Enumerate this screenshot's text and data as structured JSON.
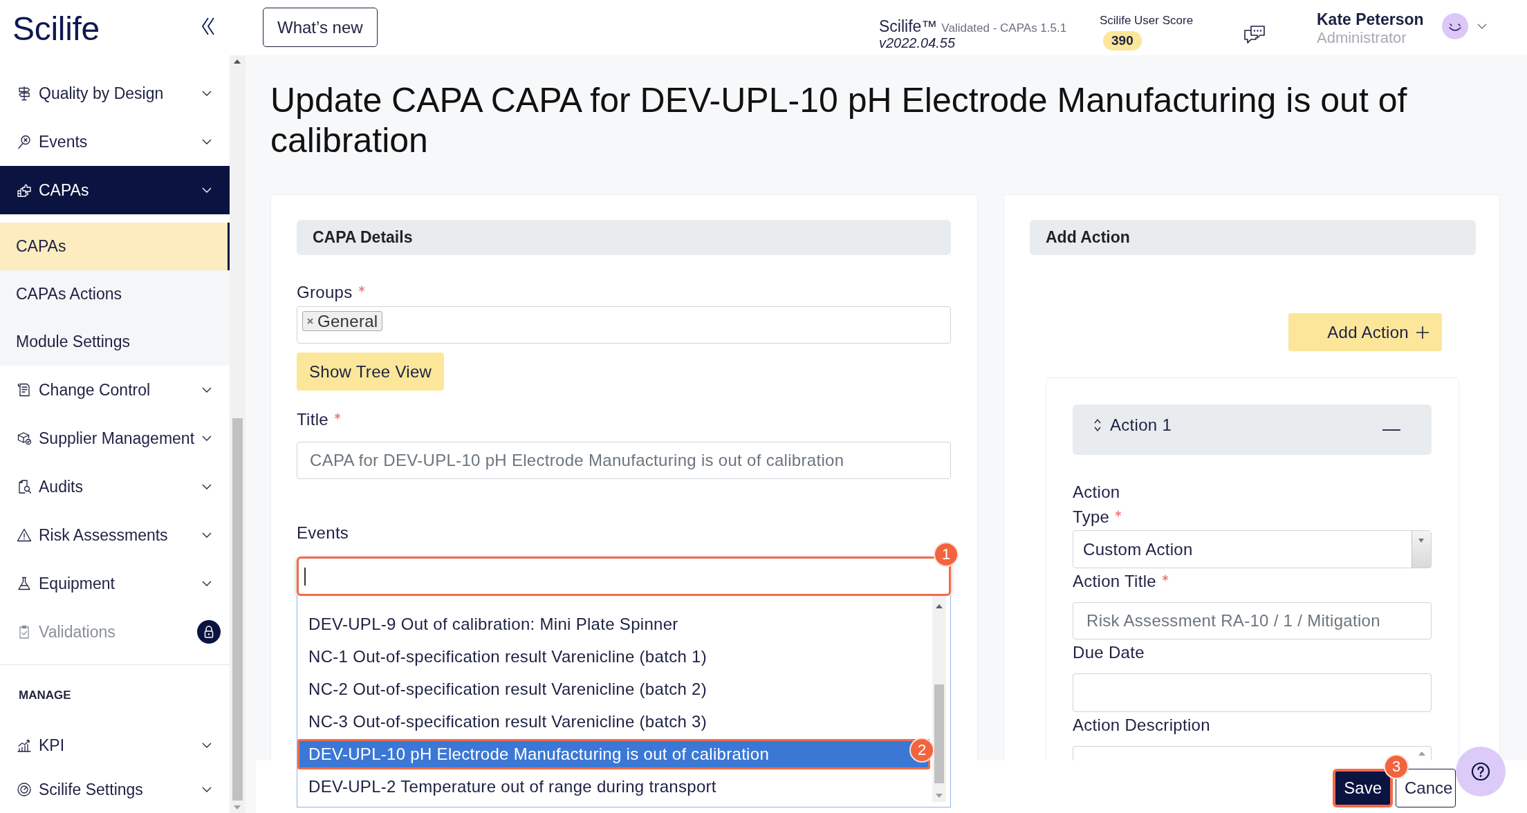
{
  "header": {
    "logo": "Scilife",
    "whats_new": "What’s new",
    "product": {
      "name": "Scilife™",
      "edition": "Validated - CAPAs 1.5.1",
      "version": "v2022.04.55"
    },
    "score": {
      "label": "Scilife User Score",
      "value": "390"
    },
    "user": {
      "name": "Kate Peterson",
      "role": "Administrator"
    }
  },
  "sidebar": {
    "sections": [
      {
        "items": [
          {
            "label": "Quality by Design",
            "expanded": false,
            "locked": false
          },
          {
            "label": "Events",
            "expanded": false,
            "locked": false
          },
          {
            "label": "CAPAs",
            "expanded": true,
            "locked": false,
            "children": [
              {
                "label": "CAPAs",
                "selected": true
              },
              {
                "label": "CAPAs Actions",
                "selected": false
              },
              {
                "label": "Module Settings",
                "selected": false
              }
            ]
          },
          {
            "label": "Change Control",
            "expanded": false,
            "locked": false
          },
          {
            "label": "Supplier Management",
            "expanded": false,
            "locked": false
          },
          {
            "label": "Audits",
            "expanded": false,
            "locked": false
          },
          {
            "label": "Risk Assessments",
            "expanded": false,
            "locked": false
          },
          {
            "label": "Equipment",
            "expanded": false,
            "locked": false
          },
          {
            "label": "Validations",
            "expanded": false,
            "locked": true
          }
        ]
      },
      {
        "heading": "MANAGE",
        "items": [
          {
            "label": "KPI",
            "expanded": false,
            "locked": false
          },
          {
            "label": "Scilife Settings",
            "expanded": false,
            "locked": false
          }
        ]
      }
    ]
  },
  "page_title": "Update CAPA CAPA for DEV-UPL-10 pH Electrode Manufacturing is out of calibration",
  "capa_details": {
    "heading": "CAPA Details",
    "groups": {
      "label": "Groups",
      "required": true,
      "tags": [
        "General"
      ]
    },
    "tree_button": "Show Tree View",
    "title_field": {
      "label": "Title",
      "required": true,
      "value": "CAPA for DEV-UPL-10 pH Electrode Manufacturing is out of calibration",
      "disabled": true
    },
    "events": {
      "label": "Events",
      "required": false,
      "search": {
        "focused": true,
        "callout": "1"
      },
      "options": [
        {
          "label": "DEV-UPL-9 Out of calibration: Mini Plate Spinner",
          "selected": false
        },
        {
          "label": "NC-1 Out-of-specification result Varenicline (batch 1)",
          "selected": false
        },
        {
          "label": "NC-2 Out-of-specification result Varenicline (batch 2)",
          "selected": false
        },
        {
          "label": "NC-3 Out-of-specification result Varenicline (batch 3)",
          "selected": false
        },
        {
          "label": "DEV-UPL-10 pH Electrode Manufacturing is out of calibration",
          "selected": true,
          "callout": "2"
        },
        {
          "label": "DEV-UPL-2 Temperature out of range during transport",
          "selected": false
        }
      ]
    }
  },
  "add_action": {
    "heading": "Add Action",
    "add_button": "Add Action",
    "actions": [
      {
        "title": "Action 1",
        "expanded": true,
        "section_label": "Action",
        "fields": [
          {
            "kind": "select",
            "label": "Type",
            "required": true,
            "value": "Custom Action",
            "disabled": false
          },
          {
            "kind": "text",
            "label": "Action Title",
            "required": true,
            "value": "Risk Assessment RA-10 / 1 / Mitigation",
            "disabled": true
          },
          {
            "kind": "date",
            "label": "Due Date",
            "required": false
          },
          {
            "kind": "textarea",
            "label": "Action Description",
            "required": false
          }
        ]
      }
    ]
  },
  "footer": {
    "save": {
      "label": "Save",
      "callout": "3"
    },
    "cancel": {
      "label": "Cance"
    }
  }
}
